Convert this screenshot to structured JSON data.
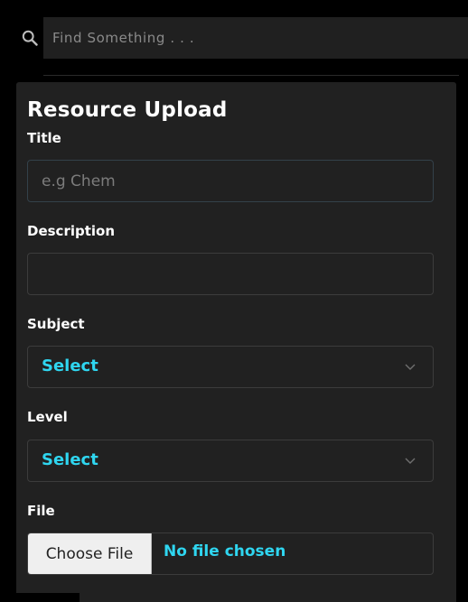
{
  "search": {
    "placeholder": "Find Something . . .",
    "icon": "search-icon"
  },
  "form": {
    "title": "Resource Upload",
    "fields": {
      "title": {
        "label": "Title",
        "placeholder": "e.g Chem",
        "value": ""
      },
      "description": {
        "label": "Description",
        "placeholder": "",
        "value": ""
      },
      "subject": {
        "label": "Subject",
        "selected": "Select"
      },
      "level": {
        "label": "Level",
        "selected": "Select"
      },
      "file": {
        "label": "File",
        "button_label": "Choose File",
        "status": "No file chosen"
      }
    }
  },
  "colors": {
    "background": "#000000",
    "panel": "#212121",
    "accent": "#2fd6f0",
    "text": "#ffffff"
  }
}
